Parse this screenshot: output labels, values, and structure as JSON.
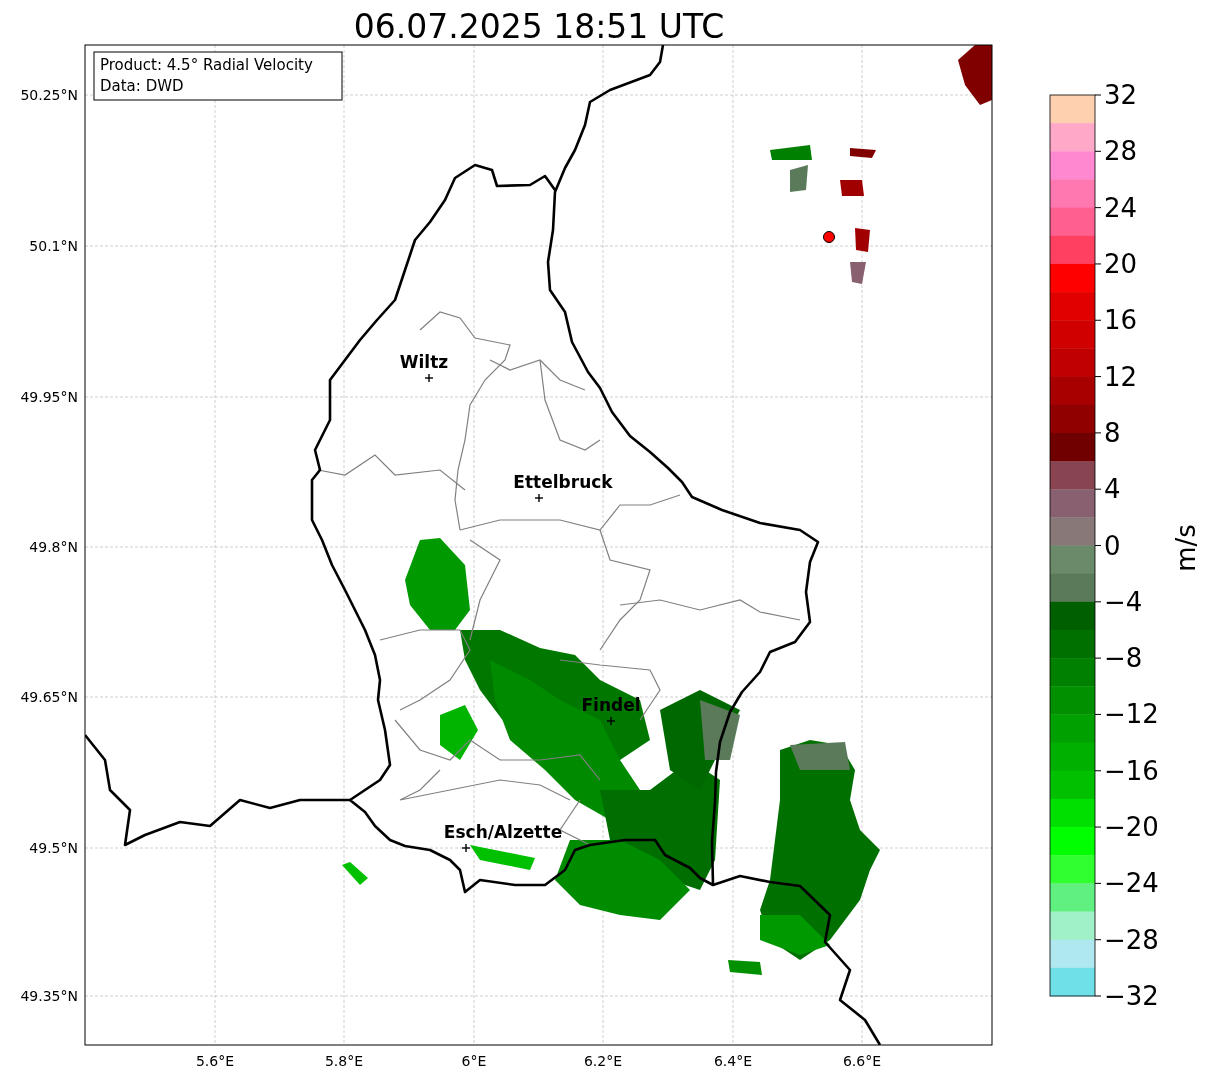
{
  "title": "06.07.2025 18:51 UTC",
  "info_box": {
    "lines": [
      "Product: 4.5° Radial Velocity",
      "Data: DWD"
    ]
  },
  "map": {
    "y_ticks": [
      "50.25°N",
      "50.1°N",
      "49.95°N",
      "49.8°N",
      "49.65°N",
      "49.5°N",
      "49.35°N"
    ],
    "x_ticks": [
      "5.6°E",
      "5.8°E",
      "6°E",
      "6.2°E",
      "6.4°E",
      "6.6°E"
    ],
    "places": [
      {
        "label": "Wiltz"
      },
      {
        "label": "Ettelbruck"
      },
      {
        "label": "Findel"
      },
      {
        "label": "Esch/Alzette"
      }
    ]
  },
  "colorbar": {
    "label": "m/s",
    "ticks": [
      "32",
      "28",
      "24",
      "20",
      "16",
      "12",
      "8",
      "4",
      "0",
      "−4",
      "−8",
      "−12",
      "−16",
      "−20",
      "−24",
      "−28",
      "−32"
    ],
    "bins": [
      {
        "color": "#ffd0b0"
      },
      {
        "color": "#ffa8c8"
      },
      {
        "color": "#ff88d0"
      },
      {
        "color": "#ff78b0"
      },
      {
        "color": "#ff6090"
      },
      {
        "color": "#ff4060"
      },
      {
        "color": "#ff0000"
      },
      {
        "color": "#e00000"
      },
      {
        "color": "#d00000"
      },
      {
        "color": "#c00000"
      },
      {
        "color": "#a80000"
      },
      {
        "color": "#900000"
      },
      {
        "color": "#700000"
      },
      {
        "color": "#884450"
      },
      {
        "color": "#886070"
      },
      {
        "color": "#887878"
      },
      {
        "color": "#6a8a6a"
      },
      {
        "color": "#5a7a5a"
      },
      {
        "color": "#006000"
      },
      {
        "color": "#007000"
      },
      {
        "color": "#008000"
      },
      {
        "color": "#009000"
      },
      {
        "color": "#00a000"
      },
      {
        "color": "#00b000"
      },
      {
        "color": "#00c000"
      },
      {
        "color": "#00e000"
      },
      {
        "color": "#00ff00"
      },
      {
        "color": "#30ff30"
      },
      {
        "color": "#60f080"
      },
      {
        "color": "#a0f0c8"
      },
      {
        "color": "#b0e8f0"
      },
      {
        "color": "#70e0e8"
      }
    ]
  }
}
